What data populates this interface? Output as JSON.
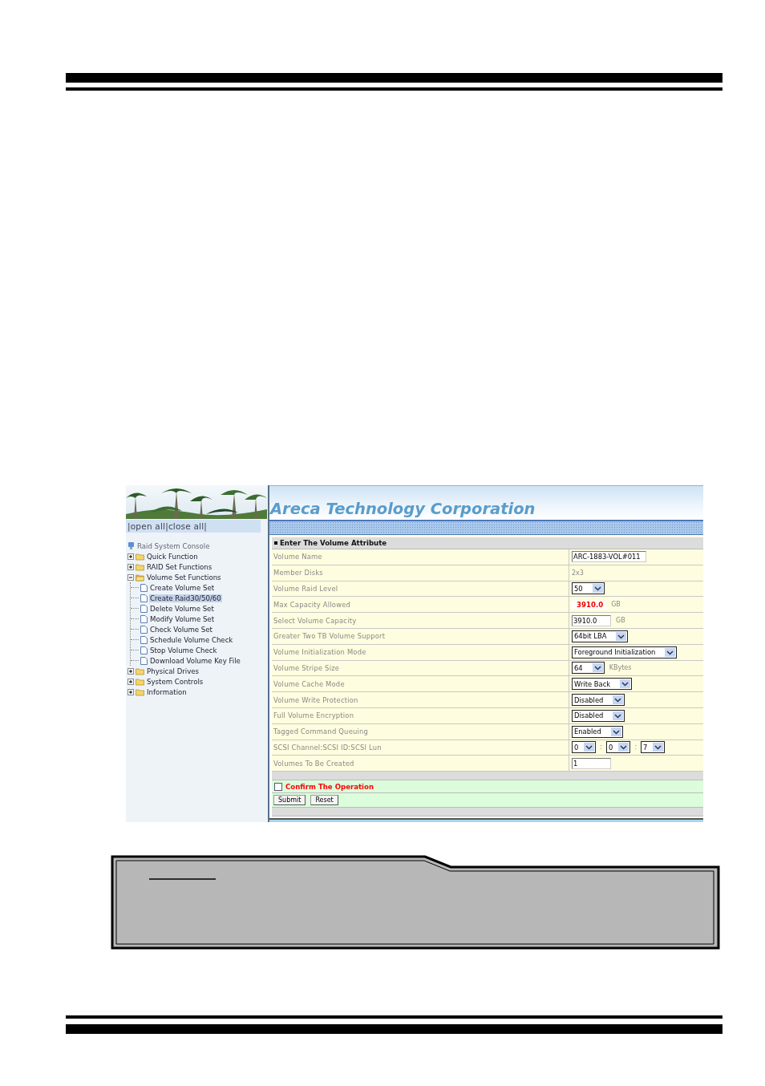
{
  "sidebar": {
    "links": [
      "|open all|close all|"
    ],
    "tree": {
      "label": "Raid System Console",
      "children": [
        {
          "label": "Quick Function",
          "kind": "folder",
          "expanded": false
        },
        {
          "label": "RAID Set Functions",
          "kind": "folder",
          "expanded": false
        },
        {
          "label": "Volume Set Functions",
          "kind": "folder",
          "expanded": true,
          "children": [
            {
              "label": "Create Volume Set",
              "kind": "page",
              "selected": false
            },
            {
              "label": "Create Raid30/50/60",
              "kind": "page",
              "selected": true
            },
            {
              "label": "Delete Volume Set",
              "kind": "page",
              "selected": false
            },
            {
              "label": "Modify Volume Set",
              "kind": "page",
              "selected": false
            },
            {
              "label": "Check Volume Set",
              "kind": "page",
              "selected": false
            },
            {
              "label": "Schedule Volume Check",
              "kind": "page",
              "selected": false
            },
            {
              "label": "Stop Volume Check",
              "kind": "page",
              "selected": false
            },
            {
              "label": "Download Volume Key File",
              "kind": "page",
              "selected": false
            }
          ]
        },
        {
          "label": "Physical Drives",
          "kind": "folder",
          "expanded": false
        },
        {
          "label": "System Controls",
          "kind": "folder",
          "expanded": false
        },
        {
          "label": "Information",
          "kind": "folder",
          "expanded": false
        }
      ]
    }
  },
  "header": {
    "title": "Areca Technology Corporation"
  },
  "form": {
    "title": "Enter The Volume Attribute",
    "rows": [
      {
        "label": "Volume Name",
        "kind": "input",
        "value": "ARC-1883-VOL#011"
      },
      {
        "label": "Member Disks",
        "kind": "text",
        "value": "2x3"
      },
      {
        "label": "Volume Raid Level",
        "kind": "select",
        "value": "50"
      },
      {
        "label": "Max Capacity Allowed",
        "kind": "emphasis",
        "value": "3910.0",
        "unit": "GB"
      },
      {
        "label": "Select Volume Capacity",
        "kind": "input",
        "value": "3910.0",
        "unit": "GB"
      },
      {
        "label": "Greater Two TB Volume Support",
        "kind": "select",
        "value": "64bit LBA"
      },
      {
        "label": "Volume Initialization Mode",
        "kind": "select",
        "value": "Foreground Initialization"
      },
      {
        "label": "Volume Stripe Size",
        "kind": "select",
        "value": "64",
        "unit": "KBytes"
      },
      {
        "label": "Volume Cache Mode",
        "kind": "select",
        "value": "Write Back"
      },
      {
        "label": "Volume Write Protection",
        "kind": "select",
        "value": "Disabled"
      },
      {
        "label": "Full Volume Encryption",
        "kind": "select",
        "value": "Disabled"
      },
      {
        "label": "Tagged Command Queuing",
        "kind": "select",
        "value": "Enabled"
      },
      {
        "label": "SCSI Channel:SCSI ID:SCSI Lun",
        "kind": "lun",
        "values": [
          "0",
          "0",
          "7"
        ],
        "separators": [
          ":",
          ":"
        ]
      },
      {
        "label": "Volumes To Be Created",
        "kind": "input",
        "value": "1"
      }
    ],
    "confirm": {
      "label": "Confirm The Operation",
      "checked": false
    },
    "buttons": [
      "Submit",
      "Reset"
    ]
  }
}
